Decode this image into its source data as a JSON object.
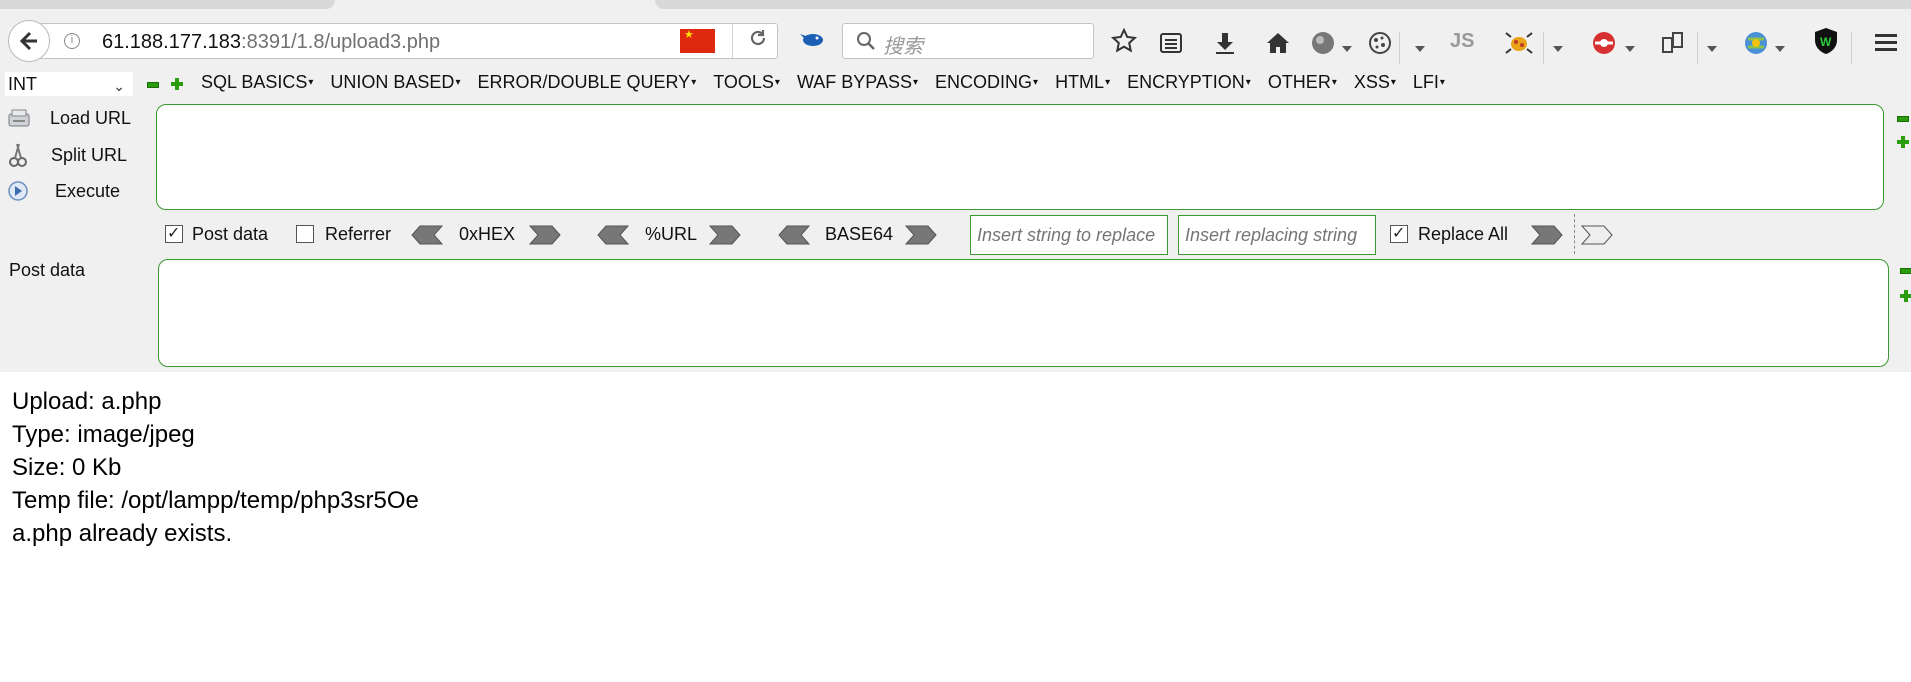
{
  "browser": {
    "url_host": "61.188.177.183",
    "url_rest": ":8391/1.8/upload3.php",
    "search_placeholder": "搜索",
    "js_label": "JS"
  },
  "hackbar": {
    "select_value": "INT",
    "menu": [
      "SQL BASICS",
      "UNION BASED",
      "ERROR/DOUBLE QUERY",
      "TOOLS",
      "WAF BYPASS",
      "ENCODING",
      "HTML",
      "ENCRYPTION",
      "OTHER",
      "XSS",
      "LFI"
    ],
    "load_url": "Load URL",
    "split_url": "Split URL",
    "execute": "Execute",
    "post_data_checkbox": "Post data",
    "post_data_checked": true,
    "referrer_checkbox": "Referrer",
    "referrer_checked": false,
    "hex_label": "0xHEX",
    "url_label": "%URL",
    "base64_label": "BASE64",
    "replace_placeholder": "Insert string to replace",
    "replacing_placeholder": "Insert replacing string",
    "replace_all_label": "Replace All",
    "replace_all_checked": true,
    "post_data_label": "Post data",
    "url_value": "",
    "post_value": ""
  },
  "page": {
    "lines": [
      "Upload: a.php",
      "Type: image/jpeg",
      "Size: 0 Kb",
      "Temp file: /opt/lampp/temp/php3sr5Oe",
      "a.php already exists."
    ]
  },
  "colors": {
    "accent_green": "#3a9a30",
    "flag_red": "#de2910"
  }
}
